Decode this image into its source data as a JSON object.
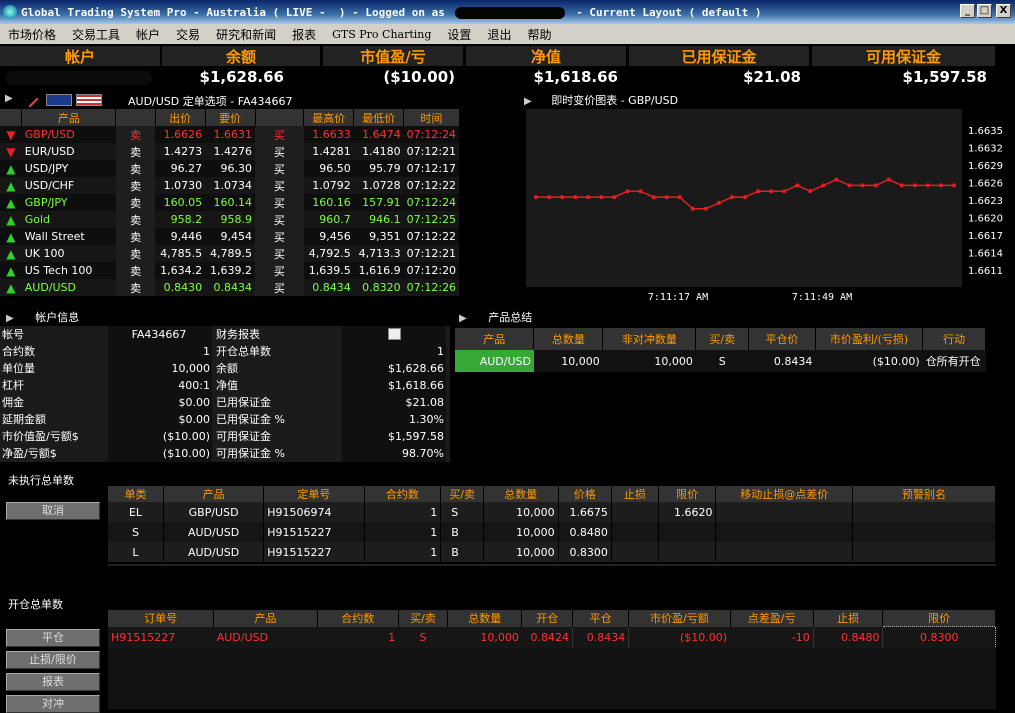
{
  "window": {
    "title_pre": "Global Trading System Pro - Australia ( LIVE -  ) - Logged on as ",
    "title_post": " - Current Layout ( default )",
    "min": "_",
    "max": "□",
    "close": "X"
  },
  "menu": [
    "市场价格",
    "交易工具",
    "帐户",
    "交易",
    "研究和新闻",
    "报表",
    "GTS Pro Charting",
    "设置",
    "退出",
    "帮助"
  ],
  "summary": {
    "account_label": "帐户",
    "labels": [
      "余额",
      "市值盈/亏",
      "净值",
      "已用保证金",
      "可用保证金"
    ],
    "values": [
      "$1,628.66",
      "($10.00)",
      "$1,618.66",
      "$21.08",
      "$1,597.58"
    ]
  },
  "quotes": {
    "toolbar_title": "AUD/USD 定单选项 - FA434667",
    "headers": [
      "产品",
      "出价",
      "要价",
      "最高价",
      "最低价",
      "时间"
    ],
    "rows": [
      {
        "dir": "down",
        "color": "red",
        "sym": "GBP/USD",
        "sell": "卖",
        "bid": "1.6626",
        "ask": "1.6631",
        "buy": "买",
        "high": "1.6633",
        "low": "1.6474",
        "time": "07:12:24"
      },
      {
        "dir": "down",
        "color": "white",
        "sym": "EUR/USD",
        "sell": "卖",
        "bid": "1.4273",
        "ask": "1.4276",
        "buy": "买",
        "high": "1.4281",
        "low": "1.4180",
        "time": "07:12:21"
      },
      {
        "dir": "up",
        "color": "white",
        "sym": "USD/JPY",
        "sell": "卖",
        "bid": "96.27",
        "ask": "96.30",
        "buy": "买",
        "high": "96.50",
        "low": "95.79",
        "time": "07:12:17"
      },
      {
        "dir": "up",
        "color": "white",
        "sym": "USD/CHF",
        "sell": "卖",
        "bid": "1.0730",
        "ask": "1.0734",
        "buy": "买",
        "high": "1.0792",
        "low": "1.0728",
        "time": "07:12:22"
      },
      {
        "dir": "up",
        "color": "green",
        "sym": "GBP/JPY",
        "sell": "卖",
        "bid": "160.05",
        "ask": "160.14",
        "buy": "买",
        "high": "160.16",
        "low": "157.91",
        "time": "07:12:24"
      },
      {
        "dir": "up",
        "color": "green",
        "sym": "Gold",
        "sell": "卖",
        "bid": "958.2",
        "ask": "958.9",
        "buy": "买",
        "high": "960.7",
        "low": "946.1",
        "time": "07:12:25"
      },
      {
        "dir": "up",
        "color": "white",
        "sym": "Wall Street",
        "sell": "卖",
        "bid": "9,446",
        "ask": "9,454",
        "buy": "买",
        "high": "9,456",
        "low": "9,351",
        "time": "07:12:22"
      },
      {
        "dir": "up",
        "color": "white",
        "sym": "UK 100",
        "sell": "卖",
        "bid": "4,785.5",
        "ask": "4,789.5",
        "buy": "买",
        "high": "4,792.5",
        "low": "4,713.3",
        "time": "07:12:21"
      },
      {
        "dir": "up",
        "color": "white",
        "sym": "US Tech 100",
        "sell": "卖",
        "bid": "1,634.2",
        "ask": "1,639.2",
        "buy": "买",
        "high": "1,639.5",
        "low": "1,616.9",
        "time": "07:12:20"
      },
      {
        "dir": "up",
        "color": "green",
        "sym": "AUD/USD",
        "sell": "卖",
        "bid": "0.8430",
        "ask": "0.8434",
        "buy": "买",
        "high": "0.8434",
        "low": "0.8320",
        "time": "07:12:26"
      }
    ]
  },
  "chart_title": "即时变价图表 - GBP/USD",
  "chart_data": {
    "type": "line",
    "title": "即时变价图表 - GBP/USD",
    "yticks": [
      "1.6635",
      "1.6632",
      "1.6629",
      "1.6626",
      "1.6623",
      "1.6620",
      "1.6617",
      "1.6614",
      "1.6611"
    ],
    "ylim": [
      1.6611,
      1.6635
    ],
    "xticks": [
      "7:11:17 AM",
      "7:11:49 AM"
    ],
    "series": [
      {
        "values": [
          1.66235,
          1.66235,
          1.66235,
          1.66235,
          1.66235,
          1.66235,
          1.66235,
          1.66245,
          1.66245,
          1.66235,
          1.66235,
          1.66235,
          1.66215,
          1.66215,
          1.66225,
          1.66235,
          1.66235,
          1.66245,
          1.66245,
          1.66245,
          1.66255,
          1.66245,
          1.66255,
          1.66265,
          1.66255,
          1.66255,
          1.66255,
          1.66265,
          1.66255,
          1.66255,
          1.66255,
          1.66255,
          1.66255
        ]
      }
    ],
    "color": "#e02020"
  },
  "account": {
    "title": "帐户信息",
    "left": [
      [
        "帐号",
        "FA434667"
      ],
      [
        "合约数",
        "1"
      ],
      [
        "单位量",
        "10,000"
      ],
      [
        "杠杆",
        "400:1"
      ],
      [
        "佣金",
        "$0.00"
      ],
      [
        "延期金额",
        "$0.00"
      ],
      [
        "市价值盈/亏额$",
        "($10.00)"
      ],
      [
        "净盈/亏额$",
        "($10.00)"
      ]
    ],
    "right": [
      [
        "财务报表",
        ""
      ],
      [
        "开仓总单数",
        "1"
      ],
      [
        "余额",
        "$1,628.66"
      ],
      [
        "净值",
        "$1,618.66"
      ],
      [
        "已用保证金",
        "$21.08"
      ],
      [
        "已用保证金 %",
        "1.30%"
      ],
      [
        "可用保证金",
        "$1,597.58"
      ],
      [
        "可用保证金 %",
        "98.70%"
      ]
    ]
  },
  "product_summary": {
    "title": "产品总结",
    "headers": [
      "产品",
      "总数量",
      "非对冲数量",
      "买/卖",
      "平仓价",
      "市价盈利/(亏损)",
      "行动"
    ],
    "rows": [
      [
        "AUD/USD",
        "10,000",
        "10,000",
        "S",
        "0.8434",
        "($10.00)",
        "仓所有开仓"
      ]
    ]
  },
  "pending": {
    "title": "未执行总单数",
    "cancel": "取消",
    "headers": [
      "单类",
      "产品",
      "定单号",
      "合约数",
      "买/卖",
      "总数量",
      "价格",
      "止损",
      "限价",
      "移动止损@点差价",
      "预警别名"
    ],
    "rows": [
      [
        "EL",
        "GBP/USD",
        "H91506974",
        "1",
        "S",
        "10,000",
        "1.6675",
        "",
        "1.6620",
        "",
        ""
      ],
      [
        "S",
        "AUD/USD",
        "H91515227",
        "1",
        "B",
        "10,000",
        "0.8480",
        "",
        "",
        "",
        ""
      ],
      [
        "L",
        "AUD/USD",
        "H91515227",
        "1",
        "B",
        "10,000",
        "0.8300",
        "",
        "",
        "",
        ""
      ]
    ]
  },
  "open": {
    "title": "开仓总单数",
    "buttons": [
      "平仓",
      "止损/限价",
      "报表",
      "对冲"
    ],
    "headers": [
      "订单号",
      "产品",
      "合约数",
      "买/卖",
      "总数量",
      "开仓",
      "平仓",
      "市价盈/亏额",
      "点差盈/亏",
      "止损",
      "限价"
    ],
    "rows": [
      [
        "H91515227",
        "AUD/USD",
        "1",
        "S",
        "10,000",
        "0.8424",
        "0.8434",
        "($10.00)",
        "-10",
        "0.8480",
        "0.8300"
      ]
    ]
  }
}
